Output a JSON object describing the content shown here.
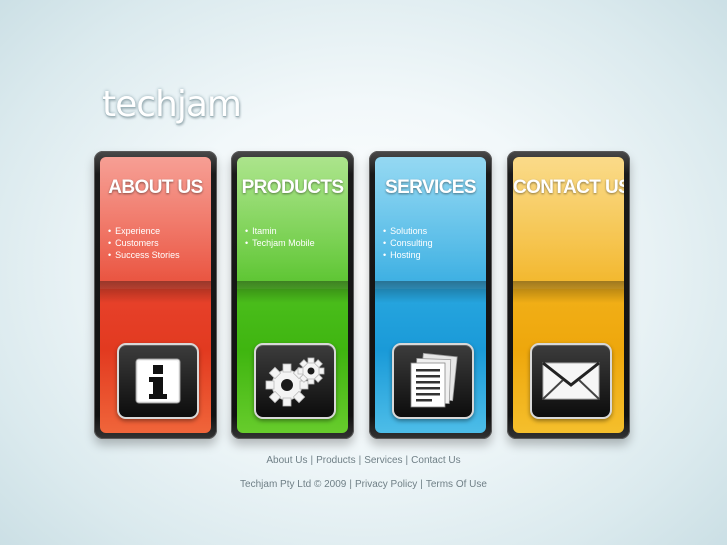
{
  "logo": "techjam",
  "panels": [
    {
      "title": "ABOUT US",
      "items": [
        "Experience",
        "Customers",
        "Success Stories"
      ],
      "icon": "info-icon",
      "color": "#e8432d"
    },
    {
      "title": "PRODUCTS",
      "items": [
        "Itamin",
        "Techjam Mobile"
      ],
      "icon": "gears-icon",
      "color": "#4ec01f"
    },
    {
      "title": "SERVICES",
      "items": [
        "Solutions",
        "Consulting",
        "Hosting"
      ],
      "icon": "documents-icon",
      "color": "#2aa8e0"
    },
    {
      "title": "CONTACT US",
      "items": [],
      "icon": "envelope-icon",
      "color": "#f2b11a"
    }
  ],
  "footer": {
    "links": [
      "About Us",
      "Products",
      "Services",
      "Contact Us"
    ],
    "copyright": "Techjam Pty Ltd © 2009",
    "legal_links": [
      "Privacy Policy",
      "Terms Of Use"
    ],
    "separator": "|"
  }
}
